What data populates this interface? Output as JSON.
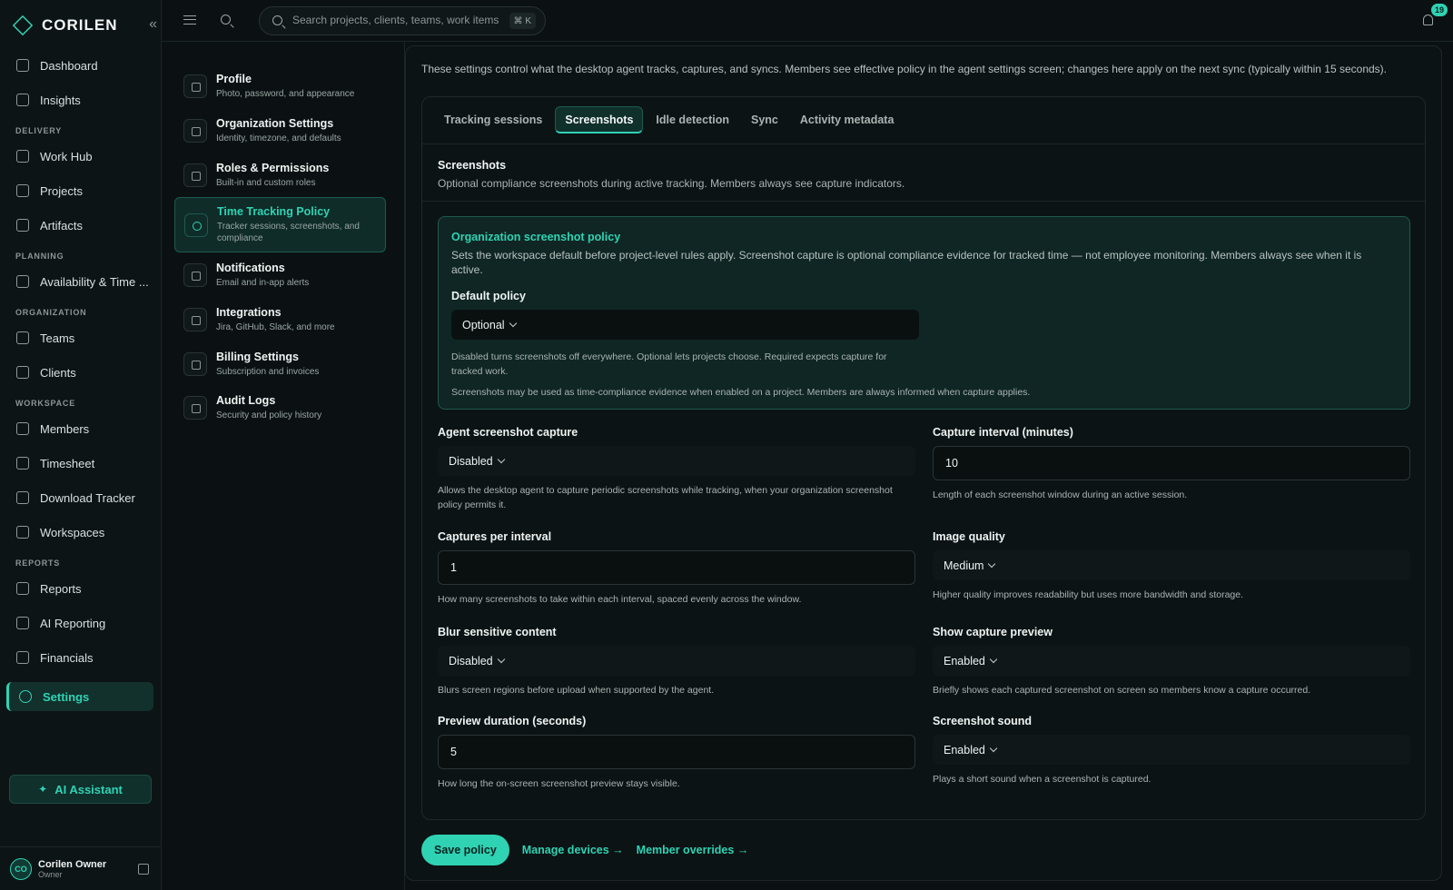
{
  "brand": {
    "name": "CORILEN"
  },
  "sidebar": {
    "top_items": [
      {
        "label": "Dashboard",
        "icon": "home-icon"
      },
      {
        "label": "Insights",
        "icon": "chart-icon"
      }
    ],
    "sections": [
      {
        "title": "DELIVERY",
        "items": [
          {
            "label": "Work Hub",
            "icon": "chart-bar-icon"
          },
          {
            "label": "Projects",
            "icon": "briefcase-icon"
          },
          {
            "label": "Artifacts",
            "icon": "file-icon"
          }
        ]
      },
      {
        "title": "PLANNING",
        "items": [
          {
            "label": "Availability & Time ...",
            "icon": "calendar-icon"
          }
        ]
      },
      {
        "title": "ORGANIZATION",
        "items": [
          {
            "label": "Teams",
            "icon": "teams-icon"
          },
          {
            "label": "Clients",
            "icon": "building-icon"
          }
        ]
      },
      {
        "title": "WORKSPACE",
        "items": [
          {
            "label": "Members",
            "icon": "id-card-icon"
          },
          {
            "label": "Timesheet",
            "icon": "calendar-icon"
          },
          {
            "label": "Download Tracker",
            "icon": "download-icon"
          },
          {
            "label": "Workspaces",
            "icon": "layers-icon"
          }
        ]
      },
      {
        "title": "REPORTS",
        "items": [
          {
            "label": "Reports",
            "icon": "file-icon"
          },
          {
            "label": "AI Reporting",
            "icon": "sparkle-icon"
          },
          {
            "label": "Financials",
            "icon": "money-icon"
          }
        ]
      }
    ],
    "active_item": {
      "label": "Settings",
      "icon": "gear-icon"
    },
    "ai_button": "AI Assistant",
    "user": {
      "initials": "CO",
      "name": "Corilen Owner",
      "role": "Owner"
    }
  },
  "topbar": {
    "search_placeholder": "Search projects, clients, teams, work items",
    "shortcut": "⌘ K",
    "notification_count": "19"
  },
  "settings_nav": [
    {
      "title": "Profile",
      "subtitle": "Photo, password, and appearance"
    },
    {
      "title": "Organization Settings",
      "subtitle": "Identity, timezone, and defaults"
    },
    {
      "title": "Roles & Permissions",
      "subtitle": "Built-in and custom roles"
    },
    {
      "title": "Time Tracking Policy",
      "subtitle": "Tracker sessions, screenshots, and compliance"
    },
    {
      "title": "Notifications",
      "subtitle": "Email and in-app alerts"
    },
    {
      "title": "Integrations",
      "subtitle": "Jira, GitHub, Slack, and more"
    },
    {
      "title": "Billing Settings",
      "subtitle": "Subscription and invoices"
    },
    {
      "title": "Audit Logs",
      "subtitle": "Security and policy history"
    }
  ],
  "main": {
    "intro": "These settings control what the desktop agent tracks, captures, and syncs. Members see effective policy in the agent settings screen; changes here apply on the next sync (typically within 15 seconds).",
    "tabs": [
      "Tracking sessions",
      "Screenshots",
      "Idle detection",
      "Sync",
      "Activity metadata"
    ],
    "active_tab": "Screenshots",
    "section_title": "Screenshots",
    "section_subtitle": "Optional compliance screenshots during active tracking. Members always see capture indicators.",
    "org_policy": {
      "title": "Organization screenshot policy",
      "description": "Sets the workspace default before project-level rules apply. Screenshot capture is optional compliance evidence for tracked time — not employee monitoring. Members always see when it is active.",
      "default_label": "Default policy",
      "default_value": "Optional",
      "help1": "Disabled turns screenshots off everywhere. Optional lets projects choose. Required expects capture for tracked work.",
      "help2": "Screenshots may be used as time-compliance evidence when enabled on a project. Members are always informed when capture applies."
    },
    "fields": {
      "agent_capture": {
        "label": "Agent screenshot capture",
        "value": "Disabled",
        "help": "Allows the desktop agent to capture periodic screenshots while tracking, when your organization screenshot policy permits it."
      },
      "capture_interval": {
        "label": "Capture interval (minutes)",
        "value": "10",
        "help": "Length of each screenshot window during an active session."
      },
      "captures_per_interval": {
        "label": "Captures per interval",
        "value": "1",
        "help": "How many screenshots to take within each interval, spaced evenly across the window."
      },
      "image_quality": {
        "label": "Image quality",
        "value": "Medium",
        "help": "Higher quality improves readability but uses more bandwidth and storage."
      },
      "blur_sensitive": {
        "label": "Blur sensitive content",
        "value": "Disabled",
        "help": "Blurs screen regions before upload when supported by the agent."
      },
      "show_preview": {
        "label": "Show capture preview",
        "value": "Enabled",
        "help": "Briefly shows each captured screenshot on screen so members know a capture occurred."
      },
      "preview_duration": {
        "label": "Preview duration (seconds)",
        "value": "5",
        "help": "How long the on-screen screenshot preview stays visible."
      },
      "screenshot_sound": {
        "label": "Screenshot sound",
        "value": "Enabled",
        "help": "Plays a short sound when a screenshot is captured."
      }
    },
    "actions": {
      "save": "Save policy",
      "manage_devices": "Manage devices →",
      "member_overrides": "Member overrides →"
    }
  }
}
